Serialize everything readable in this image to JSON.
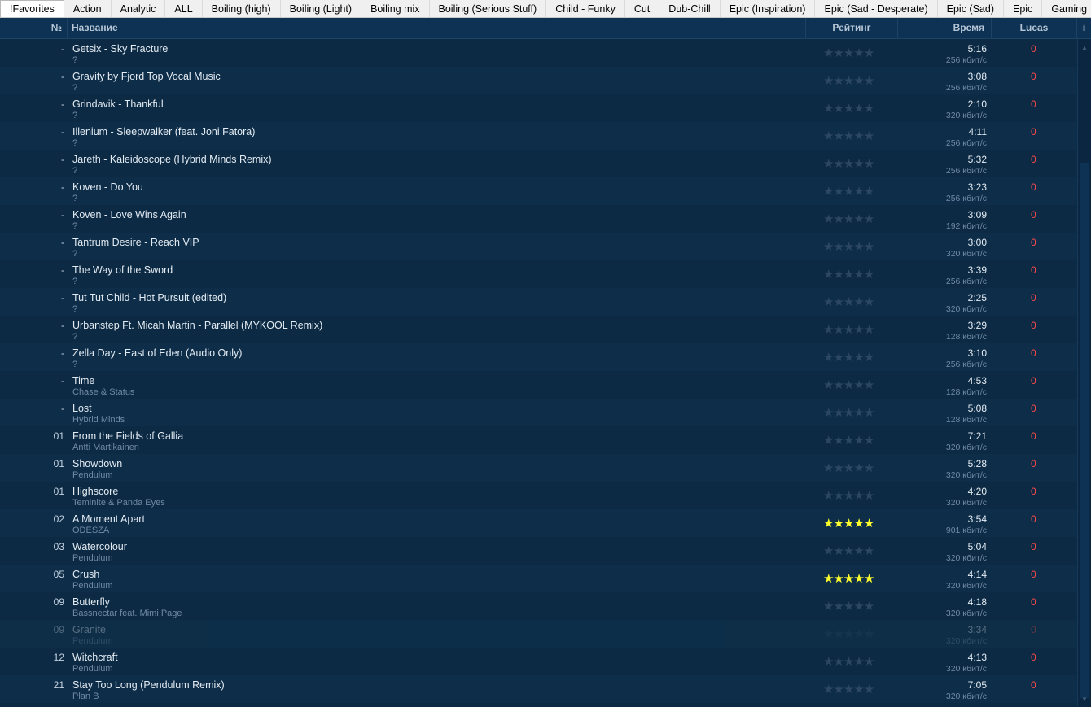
{
  "tabs": [
    "!Favorites",
    "Action",
    "Analytic",
    "ALL",
    "Boiling (high)",
    "Boiling (Light)",
    "Boiling mix",
    "Boiling (Serious Stuff)",
    "Child - Funky",
    "Cut",
    "Dub-Chill",
    "Epic (Inspiration)",
    "Epic (Sad - Desperate)",
    "Epic (Sad)",
    "Epic",
    "Gaming"
  ],
  "header": {
    "num": "№",
    "title": "Название",
    "rating": "Рейтинг",
    "time": "Время",
    "lucas": "Lucas",
    "extra": "i"
  },
  "tracks": [
    {
      "num": "-",
      "title": "Getsix - Sky Fracture",
      "artist": "?",
      "time": "5:16",
      "bitrate": "256 кбит/с",
      "plays": "0",
      "rating": 0
    },
    {
      "num": "-",
      "title": "Gravity by Fjord  Top Vocal Music",
      "artist": "?",
      "time": "3:08",
      "bitrate": "256 кбит/с",
      "plays": "0",
      "rating": 0
    },
    {
      "num": "-",
      "title": "Grindavik - Thankful",
      "artist": "?",
      "time": "2:10",
      "bitrate": "320 кбит/с",
      "plays": "0",
      "rating": 0
    },
    {
      "num": "-",
      "title": "Illenium - Sleepwalker (feat. Joni Fatora)",
      "artist": "?",
      "time": "4:11",
      "bitrate": "256 кбит/с",
      "plays": "0",
      "rating": 0
    },
    {
      "num": "-",
      "title": "Jareth - Kaleidoscope (Hybrid Minds Remix)",
      "artist": "?",
      "time": "5:32",
      "bitrate": "256 кбит/с",
      "plays": "0",
      "rating": 0
    },
    {
      "num": "-",
      "title": "Koven - Do You",
      "artist": "?",
      "time": "3:23",
      "bitrate": "256 кбит/с",
      "plays": "0",
      "rating": 0
    },
    {
      "num": "-",
      "title": "Koven - Love Wins Again",
      "artist": "?",
      "time": "3:09",
      "bitrate": "192 кбит/с",
      "plays": "0",
      "rating": 0
    },
    {
      "num": "-",
      "title": "Tantrum Desire - Reach VIP",
      "artist": "?",
      "time": "3:00",
      "bitrate": "320 кбит/с",
      "plays": "0",
      "rating": 0
    },
    {
      "num": "-",
      "title": "The Way of the Sword",
      "artist": "?",
      "time": "3:39",
      "bitrate": "256 кбит/с",
      "plays": "0",
      "rating": 0
    },
    {
      "num": "-",
      "title": "Tut Tut Child - Hot Pursuit (edited)",
      "artist": "?",
      "time": "2:25",
      "bitrate": "320 кбит/с",
      "plays": "0",
      "rating": 0
    },
    {
      "num": "-",
      "title": "Urbanstep Ft. Micah Martin - Parallel (MYKOOL Remix)",
      "artist": "?",
      "time": "3:29",
      "bitrate": "128 кбит/с",
      "plays": "0",
      "rating": 0
    },
    {
      "num": "-",
      "title": "Zella Day - East of Eden (Audio Only)",
      "artist": "?",
      "time": "3:10",
      "bitrate": "256 кбит/с",
      "plays": "0",
      "rating": 0
    },
    {
      "num": "-",
      "title": "Time",
      "artist": "Chase & Status",
      "time": "4:53",
      "bitrate": "128 кбит/с",
      "plays": "0",
      "rating": 0
    },
    {
      "num": "-",
      "title": "Lost",
      "artist": "Hybrid Minds",
      "time": "5:08",
      "bitrate": "128 кбит/с",
      "plays": "0",
      "rating": 0
    },
    {
      "num": "01",
      "title": "From the Fields of Gallia",
      "artist": "Antti Martikainen",
      "time": "7:21",
      "bitrate": "320 кбит/с",
      "plays": "0",
      "rating": 0
    },
    {
      "num": "01",
      "title": "Showdown",
      "artist": "Pendulum",
      "time": "5:28",
      "bitrate": "320 кбит/с",
      "plays": "0",
      "rating": 0
    },
    {
      "num": "01",
      "title": "Highscore",
      "artist": "Teminite & Panda Eyes",
      "time": "4:20",
      "bitrate": "320 кбит/с",
      "plays": "0",
      "rating": 0
    },
    {
      "num": "02",
      "title": "A Moment Apart",
      "artist": "ODESZA",
      "time": "3:54",
      "bitrate": "901 кбит/с",
      "plays": "0",
      "rating": 5
    },
    {
      "num": "03",
      "title": "Watercolour",
      "artist": "Pendulum",
      "time": "5:04",
      "bitrate": "320 кбит/с",
      "plays": "0",
      "rating": 0
    },
    {
      "num": "05",
      "title": "Crush",
      "artist": "Pendulum",
      "time": "4:14",
      "bitrate": "320 кбит/с",
      "plays": "0",
      "rating": 5
    },
    {
      "num": "09",
      "title": "Butterfly",
      "artist": "Bassnectar feat. Mimi Page",
      "time": "4:18",
      "bitrate": "320 кбит/с",
      "plays": "0",
      "rating": 0
    },
    {
      "num": "09",
      "title": "Granite",
      "artist": "Pendulum",
      "time": "3:34",
      "bitrate": "320 кбит/с",
      "plays": "0",
      "rating": 0,
      "faded": true
    },
    {
      "num": "12",
      "title": "Witchcraft",
      "artist": "Pendulum",
      "time": "4:13",
      "bitrate": "320 кбит/с",
      "plays": "0",
      "rating": 0
    },
    {
      "num": "21",
      "title": "Stay Too Long (Pendulum Remix)",
      "artist": "Plan B",
      "time": "7:05",
      "bitrate": "320 кбит/с",
      "plays": "0",
      "rating": 0
    }
  ],
  "colors": {
    "background": "#0c2a44",
    "header": "#0e3254",
    "star_on": "#ffff2e",
    "star_off": "#2b4762",
    "plays": "#ff4a4a"
  },
  "icons": {
    "star": "star-icon"
  },
  "scrollbar": {
    "position_fraction": 0.19
  }
}
